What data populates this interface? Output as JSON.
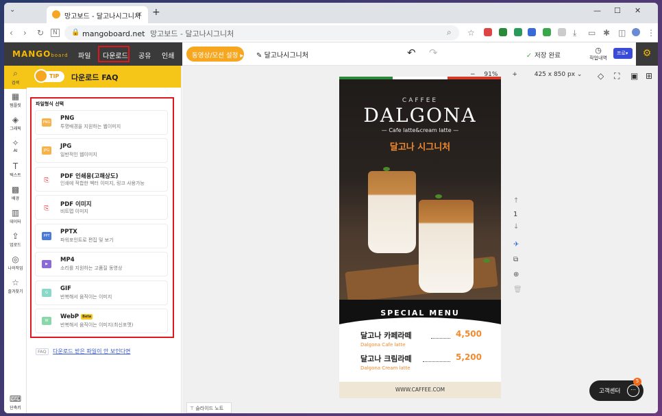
{
  "browser": {
    "tab_title": "망고보드 - 달고나시그니처",
    "tab_close": "×",
    "new_tab": "+",
    "url_domain": "mangoboard.net",
    "url_title": "망고보드 - 달고나시그니처",
    "win_min": "—",
    "win_max": "☐",
    "win_close": "✕"
  },
  "topbar": {
    "logo": "MANGO",
    "logo_sub": "board",
    "menu": [
      "파일",
      "다운로드",
      "공유",
      "인쇄"
    ],
    "anim_button": "동영상/모션 설정 ▸",
    "doc_title": "달고나시그니처",
    "saved": "저장 완료",
    "history": "작업내역",
    "pro": "프로"
  },
  "iconbar": {
    "items": [
      "검색",
      "템플릿",
      "그래픽",
      "AI",
      "텍스트",
      "배경",
      "데이터",
      "업로드",
      "나의작업",
      "즐겨찾기"
    ],
    "bottom": "단축키"
  },
  "panel": {
    "tip": "TIP",
    "title": "다운로드 FAQ",
    "format_label": "파일형식 선택",
    "formats": [
      {
        "name": "PNG",
        "desc": "투명배경을 지원하는 웹이미지",
        "icon": "png-icon"
      },
      {
        "name": "JPG",
        "desc": "일반적인 웹이미지",
        "icon": "jpg-icon"
      },
      {
        "name": "PDF 인쇄용(고해상도)",
        "desc": "인쇄에 적합한 벡터 이미지, 링크 사용가능",
        "icon": "pdf-icon"
      },
      {
        "name": "PDF 이미지",
        "desc": "비트맵 이미지",
        "icon": "pdf-image-icon"
      },
      {
        "name": "PPTX",
        "desc": "파워포인트로 편집 및 보기",
        "icon": "pptx-icon"
      },
      {
        "name": "MP4",
        "desc": "소리를 지원하는 고품질 동영상",
        "icon": "mp4-icon"
      },
      {
        "name": "GIF",
        "desc": "반복해서 움직이는 이미지",
        "icon": "gif-icon"
      },
      {
        "name": "WebP",
        "desc": "반복해서 움직이는 이미지(최신포맷)",
        "icon": "webp-icon",
        "badge": "Beta"
      }
    ],
    "faq_tag": "FAQ",
    "faq_link": "다운로드 받은 파일이 안 보인다면"
  },
  "canvas": {
    "zoom": "91%",
    "size": "425 x 850 px",
    "page_number": "1",
    "slide_note": "슬라이드 노트"
  },
  "design": {
    "brand": "CAFFEE",
    "title": "DALGONA",
    "subtitle": "— Cafe latte&cream latte —",
    "korean_title": "달고나 시그니처",
    "special": "SPECIAL MENU",
    "items": [
      {
        "ko": "달고나 카페라떼",
        "en": "Dalgona Cafe latte",
        "price": "4,500"
      },
      {
        "ko": "달고나 크림라떼",
        "en": "Dalgona Cream latte",
        "price": "5,200"
      }
    ],
    "footer": "WWW.CAFFEE.COM"
  },
  "support": {
    "label": "고객센터",
    "count": "5"
  },
  "colors": {
    "accent": "#f5c518",
    "orange": "#f7a61f",
    "highlight": "#e0161d"
  }
}
